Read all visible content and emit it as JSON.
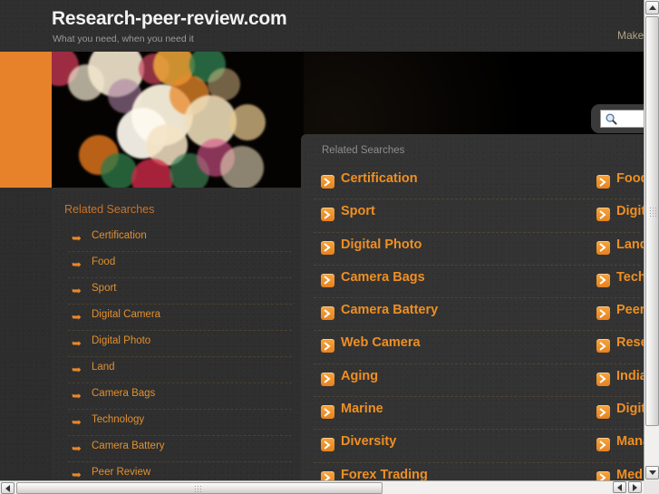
{
  "header": {
    "site_title": "Research-peer-review.com",
    "tagline": "What you need, when you need it",
    "make_link": "Make"
  },
  "search": {
    "icon": "magnifier-icon",
    "value": "",
    "placeholder": ""
  },
  "sidebar": {
    "heading": "Related Searches",
    "items": [
      {
        "label": "Certification"
      },
      {
        "label": "Food"
      },
      {
        "label": "Sport"
      },
      {
        "label": "Digital Camera"
      },
      {
        "label": "Digital Photo"
      },
      {
        "label": "Land"
      },
      {
        "label": "Camera Bags"
      },
      {
        "label": "Technology"
      },
      {
        "label": "Camera Battery"
      },
      {
        "label": "Peer Review"
      }
    ]
  },
  "panel": {
    "heading": "Related Searches",
    "rows": [
      {
        "left": "Certification",
        "right": "Food"
      },
      {
        "left": "Sport",
        "right": "Digital "
      },
      {
        "left": "Digital Photo",
        "right": "Land"
      },
      {
        "left": "Camera Bags",
        "right": "Techno"
      },
      {
        "left": "Camera Battery",
        "right": "Peer R"
      },
      {
        "left": "Web Camera",
        "right": "Resear"
      },
      {
        "left": "Aging",
        "right": "Indian"
      },
      {
        "left": "Marine",
        "right": "Digital "
      },
      {
        "left": "Diversity",
        "right": "Manag"
      },
      {
        "left": "Forex Trading",
        "right": "Medica"
      }
    ]
  },
  "colors": {
    "accent_orange": "#e8822a",
    "link_orange": "#ef8f22",
    "panel_bg": "#333333",
    "page_bg": "#2f2f2f",
    "heading_gray": "#8e8e8e"
  },
  "scrollbars": {
    "vertical_up": "scroll-up-arrow",
    "vertical_down": "scroll-down-arrow",
    "horizontal_left": "scroll-left-arrow",
    "horizontal_right": "scroll-right-arrow"
  }
}
